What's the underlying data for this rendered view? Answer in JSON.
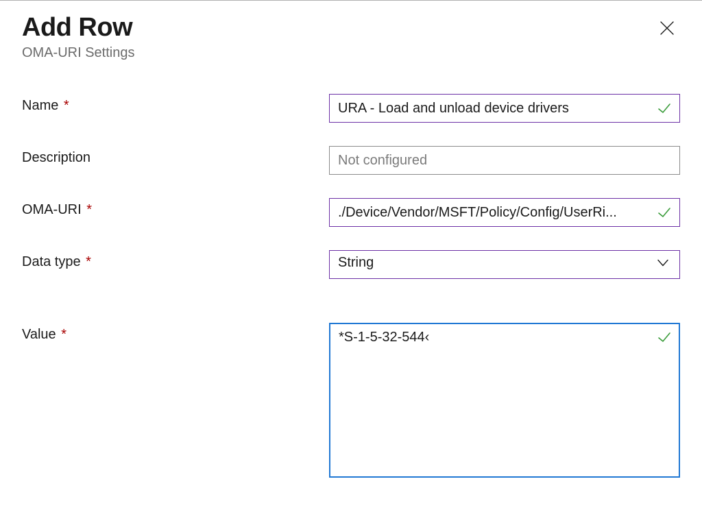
{
  "dialog": {
    "title": "Add Row",
    "subtitle": "OMA-URI Settings"
  },
  "labels": {
    "name": "Name",
    "description": "Description",
    "oma_uri": "OMA-URI",
    "data_type": "Data type",
    "value": "Value",
    "required_marker": "*"
  },
  "fields": {
    "name": "URA - Load and unload device drivers",
    "description": "",
    "description_placeholder": "Not configured",
    "oma_uri": "./Device/Vendor/MSFT/Policy/Config/UserRi...",
    "data_type": "String",
    "value": "*S-1-5-32-544‹"
  },
  "validation": {
    "name_valid": true,
    "oma_uri_valid": true,
    "value_valid": true
  }
}
